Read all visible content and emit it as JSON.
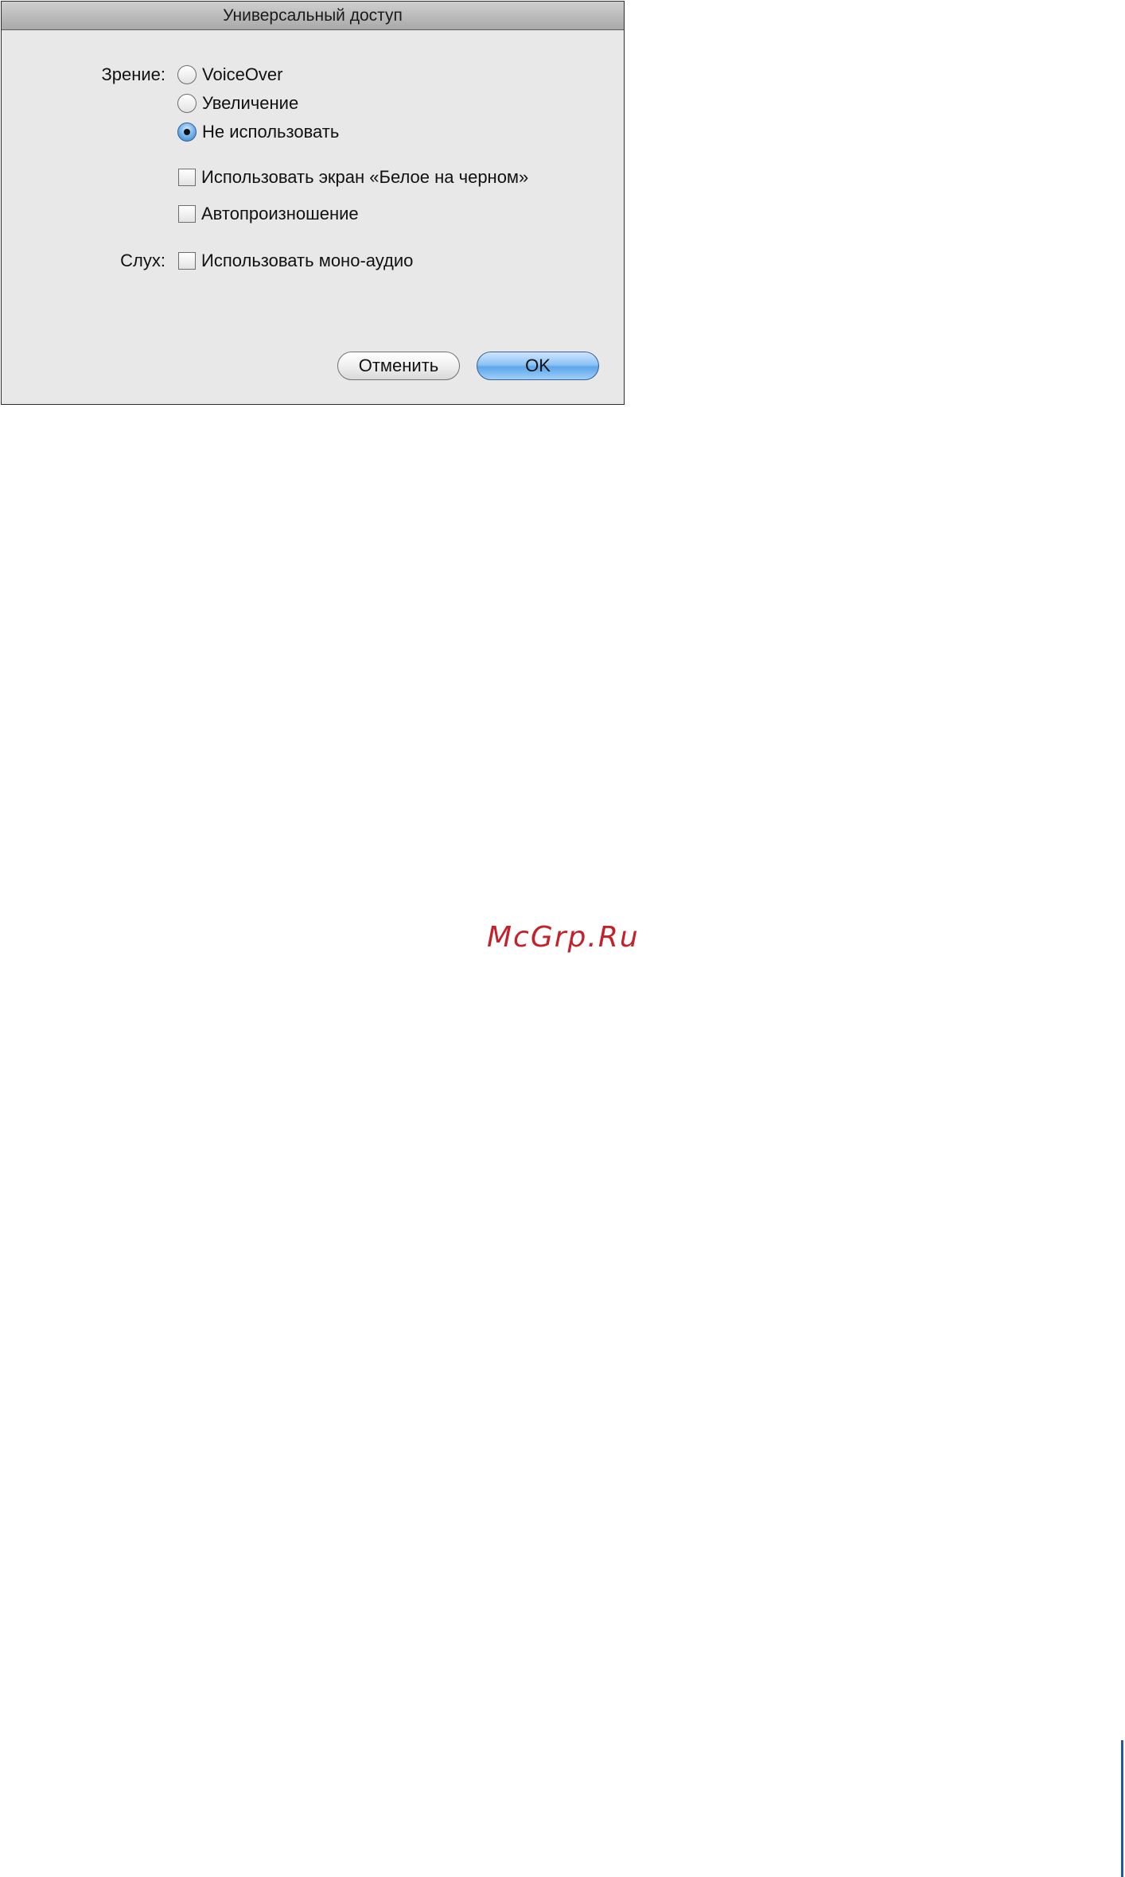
{
  "dialog": {
    "title": "Универсальный доступ",
    "vision": {
      "label": "Зрение:",
      "options": [
        {
          "label": "VoiceOver",
          "selected": false
        },
        {
          "label": "Увеличение",
          "selected": false
        },
        {
          "label": "Не использовать",
          "selected": true
        }
      ],
      "checkboxes": [
        {
          "label": "Использовать экран «Белое на черном»",
          "checked": false
        },
        {
          "label": "Автопроизношение",
          "checked": false
        }
      ]
    },
    "hearing": {
      "label": "Слух:",
      "checkboxes": [
        {
          "label": "Использовать моно-аудио",
          "checked": false
        }
      ]
    },
    "buttons": {
      "cancel": "Отменить",
      "ok": "OK"
    }
  },
  "watermark": "McGrp.Ru",
  "colors": {
    "dialog_background": "#e8e8e8",
    "default_button": "#8ec3f5",
    "watermark": "#c4212c",
    "page_edge_bar": "#1e5aa8"
  }
}
